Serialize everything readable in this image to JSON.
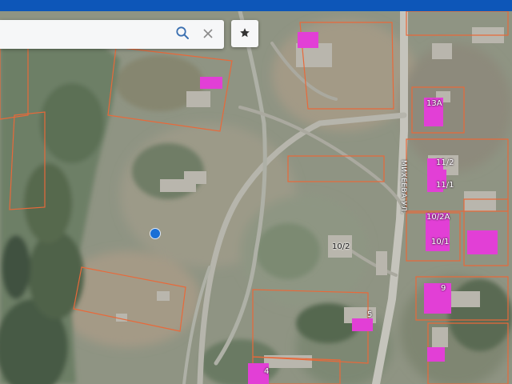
{
  "search": {
    "placeholder": "",
    "value": ""
  },
  "icons": {
    "search": "search-icon",
    "clear": "close-icon",
    "favorite": "star-icon",
    "location": "location-dot-icon"
  },
  "colors": {
    "top_bar": "#0d56b8",
    "parcel_outline": "#e8693a",
    "building_fill": "#e23fd6",
    "location_dot": "#1a6fd6"
  },
  "map": {
    "street_name": "МИХЕЕВА УЛ.",
    "house_numbers": [
      "13А",
      "11/2",
      "11/1",
      "10/2А",
      "10/1",
      "10/2",
      "9",
      "5",
      "4"
    ]
  }
}
